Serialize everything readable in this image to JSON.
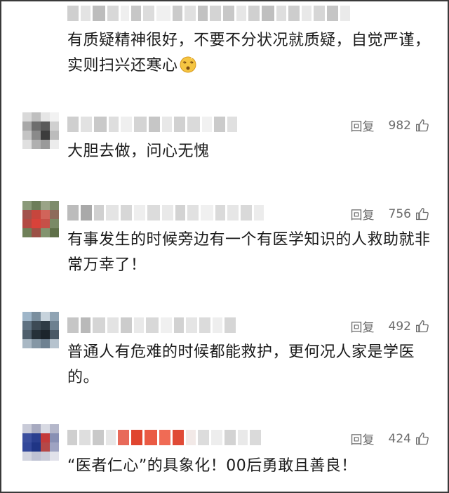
{
  "comments": [
    {
      "username": "",
      "text": "有质疑精神很好，不要不分状况就质疑，自觉严谨，实则扫兴还寒心",
      "emoji": "face-with-spiral-eyes",
      "reply_label": "",
      "likes": ""
    },
    {
      "username": "",
      "text": "大胆去做，问心无愧",
      "reply_label": "回复",
      "likes": "982"
    },
    {
      "username": "",
      "text": "有事发生的时候旁边有一个有医学知识的人救助就非常万幸了！",
      "reply_label": "回复",
      "likes": "756"
    },
    {
      "username": "",
      "text": "普通人有危难的时候都能救护，更何况人家是学医的。",
      "reply_label": "回复",
      "likes": "492"
    },
    {
      "username": "",
      "text": "“医者仁心”的具象化！00后勇敢且善良！",
      "reply_label": "回复",
      "likes": "424"
    }
  ],
  "icons": {
    "like": "thumbs-up-icon"
  },
  "colors": {
    "text": "#1a1a1a",
    "meta": "#6b6b6b",
    "frame": "#3a3a3a"
  }
}
